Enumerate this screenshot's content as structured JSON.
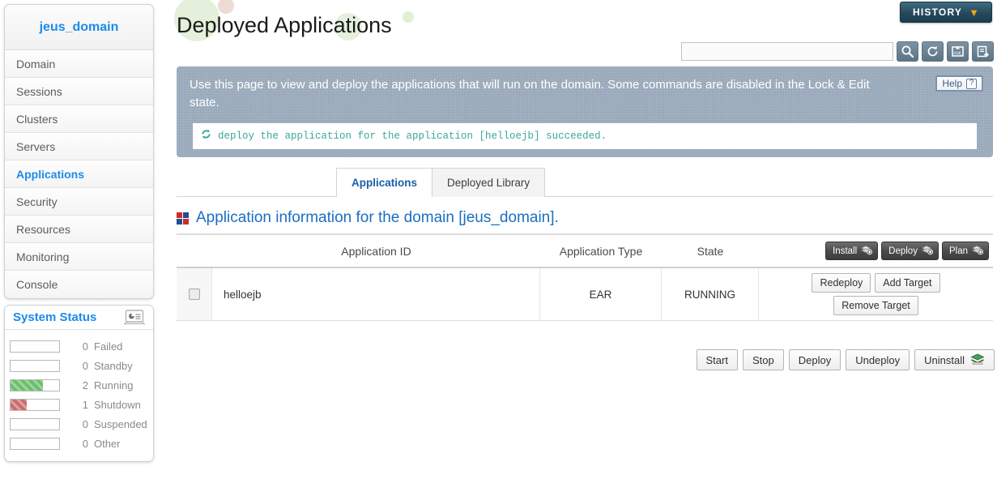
{
  "sidebar": {
    "domain_name": "jeus_domain",
    "items": [
      {
        "label": "Domain",
        "active": false
      },
      {
        "label": "Sessions",
        "active": false
      },
      {
        "label": "Clusters",
        "active": false
      },
      {
        "label": "Servers",
        "active": false
      },
      {
        "label": "Applications",
        "active": true
      },
      {
        "label": "Security",
        "active": false
      },
      {
        "label": "Resources",
        "active": false
      },
      {
        "label": "Monitoring",
        "active": false
      },
      {
        "label": "Console",
        "active": false
      }
    ],
    "status": {
      "title": "System Status",
      "icon": "laptop-chart-icon",
      "rows": [
        {
          "count": "0",
          "label": "Failed",
          "fill_pct": 0,
          "color": ""
        },
        {
          "count": "0",
          "label": "Standby",
          "fill_pct": 0,
          "color": ""
        },
        {
          "count": "2",
          "label": "Running",
          "fill_pct": 66,
          "color": "green"
        },
        {
          "count": "1",
          "label": "Shutdown",
          "fill_pct": 33,
          "color": "red"
        },
        {
          "count": "0",
          "label": "Suspended",
          "fill_pct": 0,
          "color": ""
        },
        {
          "count": "0",
          "label": "Other",
          "fill_pct": 0,
          "color": ""
        }
      ]
    }
  },
  "header": {
    "page_title": "Deployed Applications",
    "history_label": "HISTORY",
    "history_chevron": "▼"
  },
  "search": {
    "value": "",
    "placeholder": "",
    "tools": [
      {
        "icon": "search-icon"
      },
      {
        "icon": "refresh-icon"
      },
      {
        "icon": "xml-upload-icon"
      },
      {
        "icon": "report-export-icon"
      }
    ]
  },
  "banner": {
    "text": "Use this page to view and deploy the applications that will run on the domain. Some commands are disabled in the Lock & Edit state.",
    "help_label": "Help",
    "help_icon": "question-icon",
    "message_icon": "sync-icon",
    "message": "deploy the application for the application [helloejb] succeeded."
  },
  "tabs": [
    {
      "label": "Applications",
      "active": true
    },
    {
      "label": "Deployed Library",
      "active": false
    }
  ],
  "section": {
    "icon": "four-square-icon",
    "title": "Application information for the domain [jeus_domain]."
  },
  "table": {
    "columns": {
      "app_id": "Application ID",
      "app_type": "Application Type",
      "state": "State"
    },
    "header_buttons": [
      {
        "label": "Install",
        "icon": "stack-plus-icon"
      },
      {
        "label": "Deploy",
        "icon": "stack-plus-icon"
      },
      {
        "label": "Plan",
        "icon": "stack-plus-icon"
      }
    ],
    "rows": [
      {
        "checked": false,
        "app_id": "helloejb",
        "app_type": "EAR",
        "state": "RUNNING",
        "actions_line1": [
          "Redeploy",
          "Add Target"
        ],
        "actions_line2": [
          "Remove Target"
        ]
      }
    ]
  },
  "footer_buttons": [
    {
      "label": "Start",
      "icon": ""
    },
    {
      "label": "Stop",
      "icon": ""
    },
    {
      "label": "Deploy",
      "icon": ""
    },
    {
      "label": "Undeploy",
      "icon": ""
    },
    {
      "label": "Uninstall",
      "icon": "stack-icon"
    }
  ],
  "colors": {
    "accent_blue": "#1b8bea",
    "link_blue": "#1b6fc0",
    "banner_bg": "#90a1b4",
    "message_teal": "#3aa89a",
    "history_bg": "#27495c",
    "chevron_orange": "#f0a515",
    "running_green": "#6bbf6b",
    "shutdown_red": "#cc6b6b"
  }
}
